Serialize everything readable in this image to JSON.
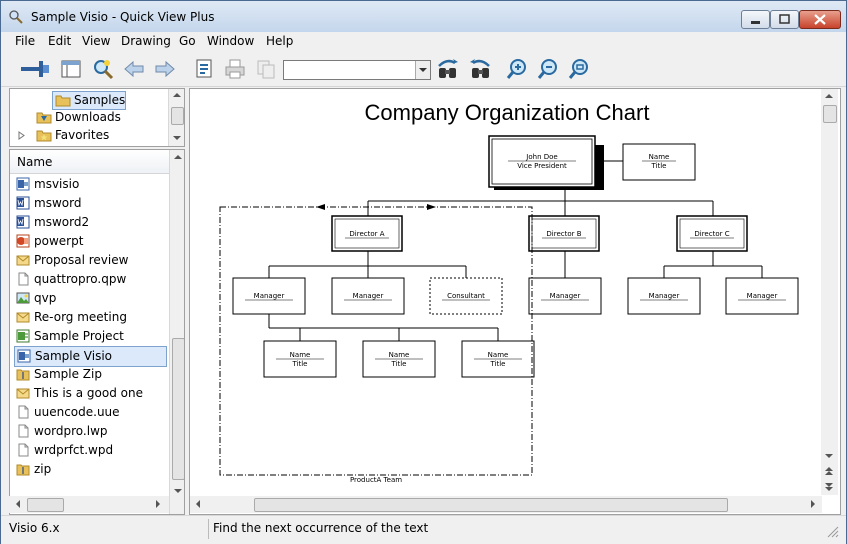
{
  "window": {
    "title": "Sample Visio - Quick View Plus"
  },
  "menu": [
    "File",
    "Edit",
    "View",
    "Drawing",
    "Go",
    "Window",
    "Help"
  ],
  "find": {
    "value": ""
  },
  "tree": [
    {
      "label": "Samples",
      "icon": "folder-icon",
      "indent": 3,
      "selected": true
    },
    {
      "label": "Downloads",
      "icon": "downloads-folder-icon",
      "indent": 2
    },
    {
      "label": "Favorites",
      "icon": "favorites-folder-icon",
      "indent": 2,
      "expandable": true
    }
  ],
  "list": {
    "header": "Name",
    "items": [
      {
        "label": "msvisio",
        "icon": "visio-file-icon"
      },
      {
        "label": "msword",
        "icon": "word-file-icon"
      },
      {
        "label": "msword2",
        "icon": "word-file-icon"
      },
      {
        "label": "powerpt",
        "icon": "powerpoint-file-icon"
      },
      {
        "label": "Proposal review",
        "icon": "email-icon"
      },
      {
        "label": "quattropro.qpw",
        "icon": "blank-file-icon"
      },
      {
        "label": "qvp",
        "icon": "image-file-icon"
      },
      {
        "label": "Re-org meeting",
        "icon": "email-icon"
      },
      {
        "label": "Sample Project",
        "icon": "project-file-icon"
      },
      {
        "label": "Sample Visio",
        "icon": "visio-file-icon",
        "selected": true
      },
      {
        "label": "Sample Zip",
        "icon": "zip-folder-icon"
      },
      {
        "label": "This is a good one",
        "icon": "email-icon"
      },
      {
        "label": "uuencode.uue",
        "icon": "blank-file-icon"
      },
      {
        "label": "wordpro.lwp",
        "icon": "blank-file-icon"
      },
      {
        "label": "wrdprfct.wpd",
        "icon": "blank-file-icon"
      },
      {
        "label": "zip",
        "icon": "zip-folder-icon"
      }
    ]
  },
  "document": {
    "title": "Company Organization Chart",
    "vp": {
      "name": "John Doe",
      "title": "Vice President"
    },
    "side": {
      "name": "Name",
      "title": "Title"
    },
    "directors": [
      "Director A",
      "Director B",
      "Director C"
    ],
    "managers": [
      "Manager",
      "Manager",
      "Consultant",
      "Manager",
      "Manager",
      "Manager"
    ],
    "staff": [
      {
        "name": "Name",
        "title": "Title"
      },
      {
        "name": "Name",
        "title": "Title"
      },
      {
        "name": "Name",
        "title": "Title"
      }
    ],
    "team_label": "ProductA Team"
  },
  "status": {
    "left": "Visio 6.x",
    "right": "Find the next occurrence of the text"
  },
  "colors": {
    "selection": "#dbe9fb",
    "titlebar": "#c4d6ec",
    "close": "#c7432b"
  }
}
